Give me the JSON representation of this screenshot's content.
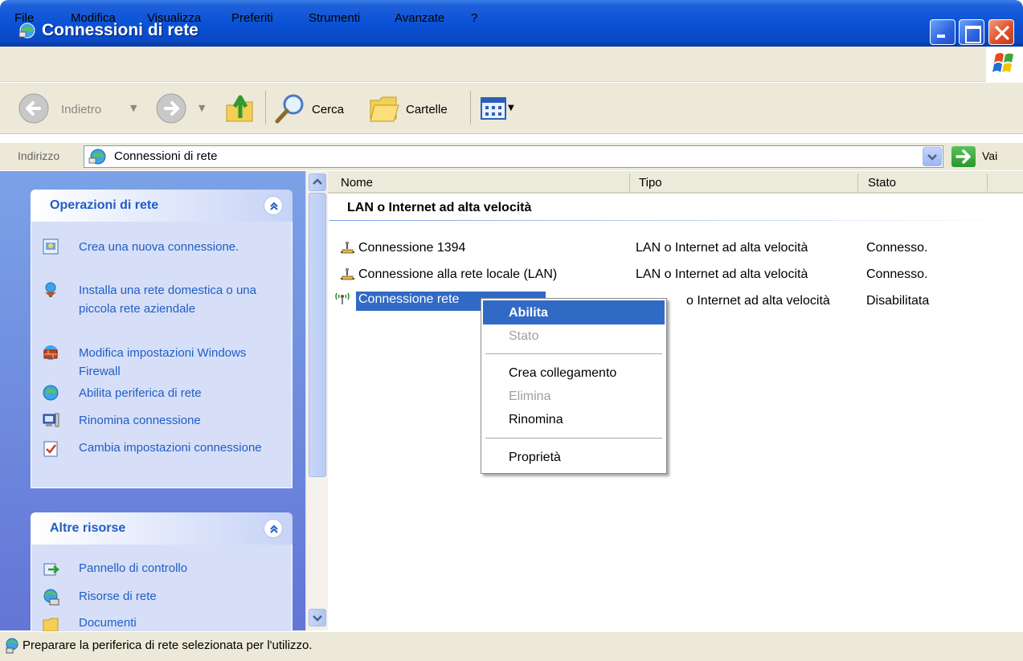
{
  "window": {
    "title": "Connessioni di rete"
  },
  "menu": [
    "File",
    "Modifica",
    "Visualizza",
    "Preferiti",
    "Strumenti",
    "Avanzate",
    "?"
  ],
  "toolbar": {
    "back_label": "Indietro",
    "search_label": "Cerca",
    "folders_label": "Cartelle"
  },
  "address": {
    "label": "Indirizzo",
    "value": "Connessioni di rete",
    "go_label": "Vai"
  },
  "left_pane": {
    "network_tasks": {
      "title": "Operazioni di rete",
      "items": [
        {
          "label": "Crea una nuova connessione.",
          "icon": "new-connection-icon"
        },
        {
          "label": "Installa una rete domestica o una piccola rete aziendale",
          "icon": "home-network-icon"
        },
        {
          "label": "Modifica impostazioni Windows Firewall",
          "icon": "firewall-icon"
        },
        {
          "label": "Abilita periferica di rete",
          "icon": "enable-device-icon"
        },
        {
          "label": "Rinomina connessione",
          "icon": "rename-icon"
        },
        {
          "label": "Cambia impostazioni connessione",
          "icon": "settings-icon"
        }
      ]
    },
    "other_places": {
      "title": "Altre risorse",
      "items": [
        {
          "label": "Pannello di controllo",
          "icon": "control-panel-icon"
        },
        {
          "label": "Risorse di rete",
          "icon": "network-places-icon"
        },
        {
          "label": "Documenti",
          "icon": "documents-icon"
        }
      ]
    }
  },
  "list": {
    "columns": [
      "Nome",
      "Tipo",
      "Stato"
    ],
    "group": "LAN o Internet ad alta velocità",
    "rows": [
      {
        "name": "Connessione 1394",
        "type": "LAN o Internet ad alta velocità",
        "status": "Connesso."
      },
      {
        "name": "Connessione alla rete locale (LAN)",
        "type": "LAN o Internet ad alta velocità",
        "status": "Connesso."
      },
      {
        "name": "Connessione rete ",
        "type": "o Internet ad alta velocità",
        "status": "Disabilitata"
      }
    ]
  },
  "context_menu": {
    "items": [
      "Abilita",
      "Stato",
      "Crea collegamento",
      "Elimina",
      "Rinomina",
      "Proprietà"
    ]
  },
  "status_bar": {
    "text": "Preparare la periferica di rete selezionata per l'utilizzo."
  },
  "colors": {
    "title_blue": "#0a52d6",
    "selection": "#316ac5",
    "task_link": "#215dc6"
  }
}
